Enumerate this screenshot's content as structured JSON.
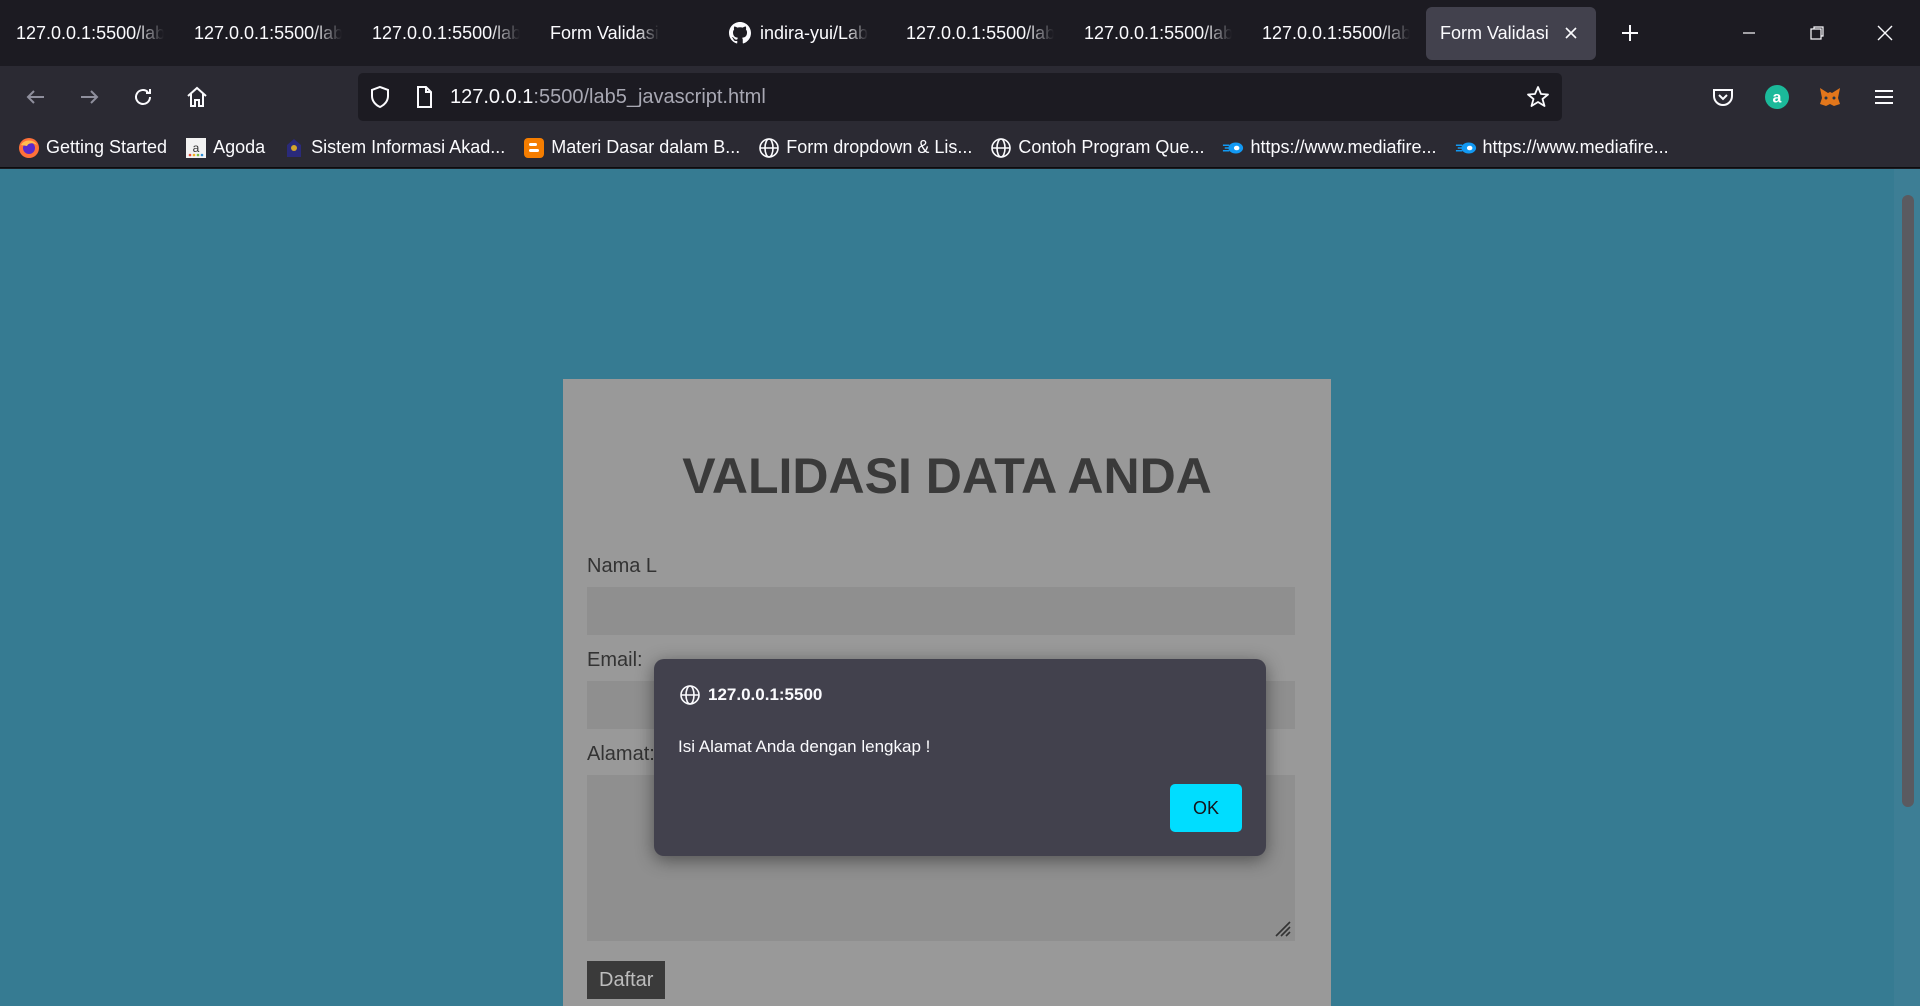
{
  "browser": {
    "tabs": [
      {
        "label": "127.0.0.1:5500/lab",
        "active": false,
        "icon": "none"
      },
      {
        "label": "127.0.0.1:5500/lab",
        "active": false,
        "icon": "none"
      },
      {
        "label": "127.0.0.1:5500/lab",
        "active": false,
        "icon": "none"
      },
      {
        "label": "Form Validasi",
        "active": false,
        "icon": "none"
      },
      {
        "label": "indira-yui/Lab",
        "active": false,
        "icon": "github-icon"
      },
      {
        "label": "127.0.0.1:5500/lab",
        "active": false,
        "icon": "none"
      },
      {
        "label": "127.0.0.1:5500/lab",
        "active": false,
        "icon": "none"
      },
      {
        "label": "127.0.0.1:5500/lab",
        "active": false,
        "icon": "none"
      },
      {
        "label": "Form Validasi",
        "active": true,
        "icon": "none"
      }
    ],
    "url": {
      "host": "127.0.0.1",
      "rest": ":5500/lab5_javascript.html"
    },
    "bookmarks": [
      {
        "label": "Getting Started",
        "icon": "firefox-icon"
      },
      {
        "label": "Agoda",
        "icon": "agoda-icon"
      },
      {
        "label": "Sistem Informasi Akad...",
        "icon": "university-icon"
      },
      {
        "label": "Materi Dasar dalam B...",
        "icon": "blogger-icon"
      },
      {
        "label": "Form dropdown & Lis...",
        "icon": "globe-icon"
      },
      {
        "label": "Contoh Program Que...",
        "icon": "globe-icon"
      },
      {
        "label": "https://www.mediafire...",
        "icon": "mediafire-icon"
      },
      {
        "label": "https://www.mediafire...",
        "icon": "mediafire-icon"
      }
    ]
  },
  "page": {
    "title": "VALIDASI DATA ANDA",
    "fields": {
      "nama_label": "Nama L",
      "email_label": "Email:",
      "alamat_label": "Alamat:"
    },
    "submit_label": "Daftar"
  },
  "dialog": {
    "origin": "127.0.0.1:5500",
    "message": "Isi Alamat Anda dengan lengkap !",
    "ok_label": "OK"
  },
  "colors": {
    "page_bg": "#367b92",
    "form_bg": "#999999",
    "dialog_bg": "#42414d",
    "ok_button": "#00ddff",
    "browser_chrome": "#2b2a33"
  }
}
